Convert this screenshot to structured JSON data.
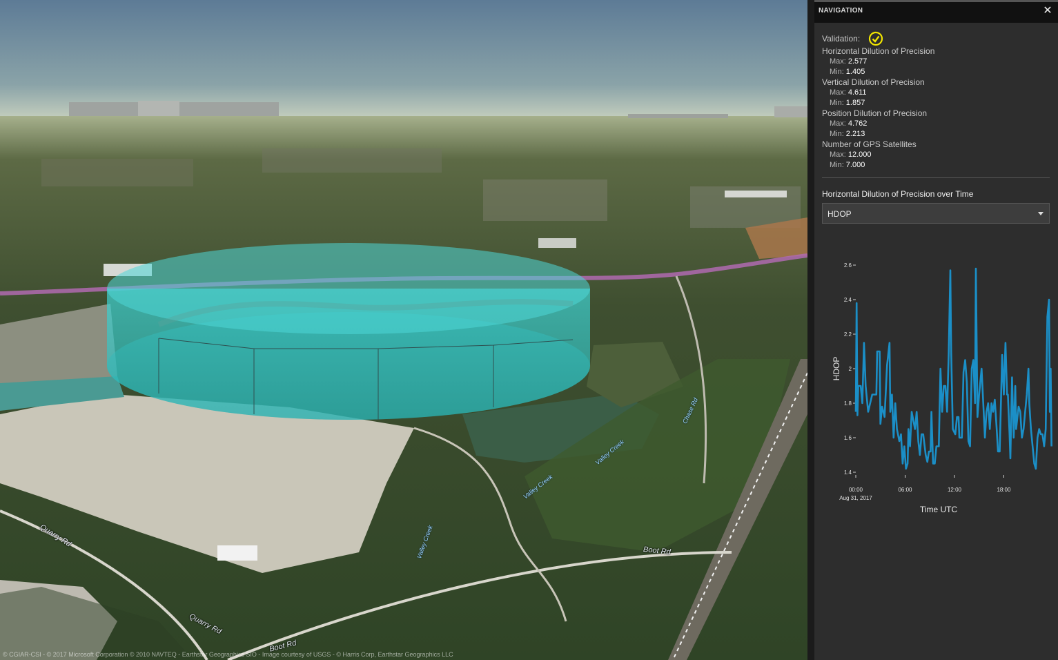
{
  "map": {
    "attribution": "© CGIAR-CSI - © 2017 Microsoft Corporation © 2010 NAVTEQ - Earthstar Geographics SIO - Image courtesy of USGS - © Harris Corp, Earthstar Geographics LLC",
    "labels": {
      "quarry_rd_1": "Quarry Rd",
      "quarry_rd_2": "Quarry Rd",
      "boot_rd_1": "Boot Rd",
      "boot_rd_2": "Boot Rd",
      "valley_creek_1": "Valley Creek",
      "valley_creek_2": "Valley Creek",
      "valley_creek_3": "Valley Creek",
      "chase_rd": "Chase Rd",
      "creek_rd": "Valley Creek"
    },
    "colors": {
      "sky_top": "#5f7f9a",
      "horizon": "#c9d2c0",
      "cylinder": "#2ec2c2",
      "highway": "#b06ab0"
    }
  },
  "panel": {
    "title": "NAVIGATION",
    "close_icon": "close-icon",
    "validation_label": "Validation:",
    "validation_icon": "check-circle-icon",
    "metrics": [
      {
        "title": "Horizontal Dilution of Precision",
        "max_label": "Max:",
        "max": "2.577",
        "min_label": "Min:",
        "min": "1.405"
      },
      {
        "title": "Vertical Dilution of Precision",
        "max_label": "Max:",
        "max": "4.611",
        "min_label": "Min:",
        "min": "1.857"
      },
      {
        "title": "Position Dilution of Precision",
        "max_label": "Max:",
        "max": "4.762",
        "min_label": "Min:",
        "min": "2.213"
      },
      {
        "title": "Number of GPS Satellites",
        "max_label": "Max:",
        "max": "12.000",
        "min_label": "Min:",
        "min": "7.000"
      }
    ],
    "chart_heading": "Horizontal Dilution of Precision over Time",
    "select_value": "HDOP",
    "accent": "#1b8fc7",
    "check_color": "#f2e600"
  },
  "chart_data": {
    "type": "line",
    "xlabel": "Time UTC",
    "ylabel": "HDOP",
    "ylim": [
      1.4,
      2.6
    ],
    "xlim": [
      0,
      23.5
    ],
    "yticks": [
      "1.4",
      "1.6",
      "1.8",
      "2",
      "2.2",
      "2.4",
      "2.6"
    ],
    "xticks": [
      {
        "v": 0,
        "label": "00:00",
        "sub": "Aug 31, 2017"
      },
      {
        "v": 6,
        "label": "06:00",
        "sub": ""
      },
      {
        "v": 12,
        "label": "12:00",
        "sub": ""
      },
      {
        "v": 18,
        "label": "18:00",
        "sub": ""
      }
    ],
    "series": [
      {
        "points": [
          [
            0,
            1.75
          ],
          [
            0.1,
            2.38
          ],
          [
            0.2,
            1.73
          ],
          [
            0.3,
            1.9
          ],
          [
            0.6,
            1.9
          ],
          [
            0.8,
            1.8
          ],
          [
            1.0,
            2.15
          ],
          [
            1.2,
            1.9
          ],
          [
            1.5,
            1.75
          ],
          [
            2.0,
            1.85
          ],
          [
            2.5,
            1.85
          ],
          [
            2.6,
            2.1
          ],
          [
            2.9,
            2.1
          ],
          [
            3.0,
            1.68
          ],
          [
            3.2,
            1.78
          ],
          [
            3.5,
            1.72
          ],
          [
            3.8,
            2.02
          ],
          [
            4.1,
            2.15
          ],
          [
            4.2,
            1.75
          ],
          [
            4.4,
            1.85
          ],
          [
            4.6,
            1.6
          ],
          [
            4.8,
            1.8
          ],
          [
            5.0,
            1.65
          ],
          [
            5.3,
            1.58
          ],
          [
            5.5,
            1.62
          ],
          [
            5.7,
            1.45
          ],
          [
            5.9,
            1.55
          ],
          [
            6.1,
            1.42
          ],
          [
            6.3,
            1.45
          ],
          [
            6.4,
            1.65
          ],
          [
            6.6,
            1.55
          ],
          [
            6.8,
            1.75
          ],
          [
            7.0,
            1.7
          ],
          [
            7.2,
            1.65
          ],
          [
            7.4,
            1.75
          ],
          [
            7.6,
            1.58
          ],
          [
            7.8,
            1.5
          ],
          [
            8.0,
            1.62
          ],
          [
            8.2,
            1.62
          ],
          [
            8.5,
            1.5
          ],
          [
            8.7,
            1.46
          ],
          [
            8.9,
            1.52
          ],
          [
            9.1,
            1.52
          ],
          [
            9.2,
            1.75
          ],
          [
            9.4,
            1.45
          ],
          [
            9.6,
            1.45
          ],
          [
            9.8,
            1.55
          ],
          [
            10.1,
            1.55
          ],
          [
            10.3,
            2.0
          ],
          [
            10.5,
            1.75
          ],
          [
            10.7,
            1.9
          ],
          [
            10.9,
            1.9
          ],
          [
            11.1,
            1.75
          ],
          [
            11.3,
            2.08
          ],
          [
            11.5,
            2.57
          ],
          [
            11.6,
            2.1
          ],
          [
            11.8,
            1.65
          ],
          [
            12.1,
            1.62
          ],
          [
            12.3,
            1.72
          ],
          [
            12.5,
            1.72
          ],
          [
            12.6,
            1.6
          ],
          [
            12.9,
            1.6
          ],
          [
            13.1,
            1.98
          ],
          [
            13.3,
            2.05
          ],
          [
            13.5,
            1.92
          ],
          [
            13.7,
            1.58
          ],
          [
            13.9,
            1.55
          ],
          [
            14.1,
            2.0
          ],
          [
            14.3,
            2.05
          ],
          [
            14.5,
            1.8
          ],
          [
            14.6,
            2.58
          ],
          [
            14.8,
            1.72
          ],
          [
            15.0,
            1.85
          ],
          [
            15.3,
            2.0
          ],
          [
            15.5,
            1.8
          ],
          [
            15.7,
            1.6
          ],
          [
            15.9,
            1.75
          ],
          [
            16.1,
            1.8
          ],
          [
            16.3,
            1.65
          ],
          [
            16.5,
            1.8
          ],
          [
            16.7,
            1.75
          ],
          [
            16.9,
            1.82
          ],
          [
            17.1,
            1.68
          ],
          [
            17.3,
            1.52
          ],
          [
            17.5,
            1.52
          ],
          [
            17.8,
            2.08
          ],
          [
            18.0,
            1.85
          ],
          [
            18.2,
            2.15
          ],
          [
            18.4,
            1.85
          ],
          [
            18.5,
            1.85
          ],
          [
            18.7,
            1.62
          ],
          [
            18.8,
            1.48
          ],
          [
            19.0,
            1.95
          ],
          [
            19.2,
            1.6
          ],
          [
            19.4,
            1.9
          ],
          [
            19.5,
            1.65
          ],
          [
            19.8,
            1.78
          ],
          [
            20.0,
            1.75
          ],
          [
            20.2,
            1.6
          ],
          [
            20.4,
            1.65
          ],
          [
            20.6,
            1.75
          ],
          [
            20.8,
            1.85
          ],
          [
            21.0,
            2.0
          ],
          [
            21.1,
            1.8
          ],
          [
            21.3,
            1.65
          ],
          [
            21.5,
            1.55
          ],
          [
            21.7,
            1.45
          ],
          [
            21.9,
            1.42
          ],
          [
            22.1,
            1.6
          ],
          [
            22.3,
            1.65
          ],
          [
            22.5,
            1.62
          ],
          [
            22.7,
            1.62
          ],
          [
            22.9,
            1.55
          ],
          [
            23.1,
            1.65
          ],
          [
            23.3,
            2.3
          ],
          [
            23.5,
            2.4
          ],
          [
            23.6,
            1.75
          ],
          [
            23.7,
            2.0
          ],
          [
            23.8,
            1.55
          ]
        ]
      }
    ]
  }
}
